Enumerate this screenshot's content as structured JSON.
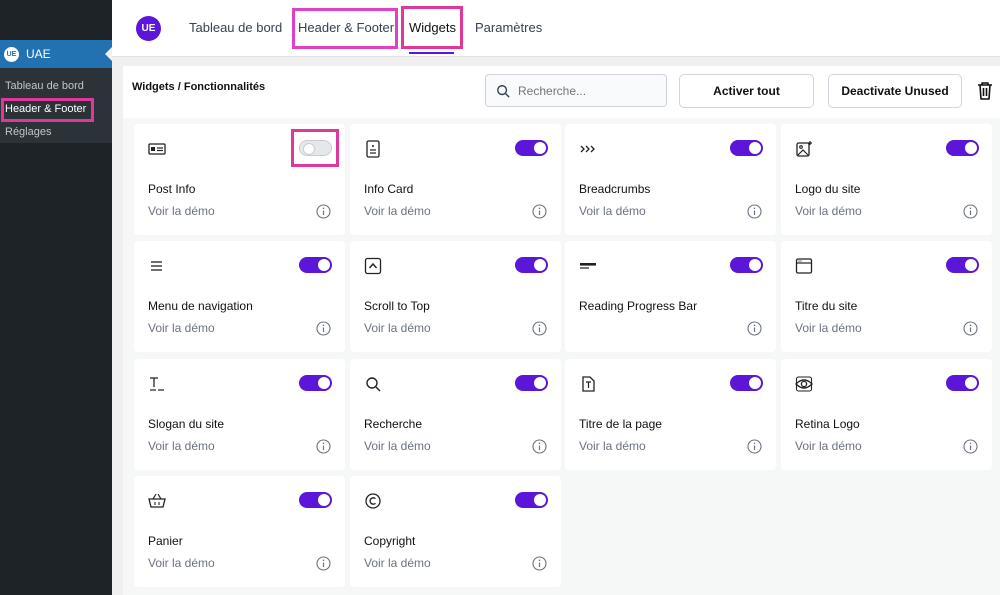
{
  "wp_sidebar": {
    "menu_label": "UAE",
    "menu_icon_text": "UE",
    "submenu": [
      "Tableau de bord",
      "Header & Footer",
      "Réglages"
    ]
  },
  "header": {
    "logo_text": "UE",
    "tabs": [
      "Tableau de bord",
      "Header & Footer",
      "Widgets",
      "Paramètres"
    ],
    "active_tab": "Widgets"
  },
  "toolbar": {
    "title": "Widgets / Fonctionnalités",
    "search_placeholder": "Recherche...",
    "activate_all": "Activer tout",
    "deactivate_unused": "Deactivate Unused"
  },
  "demo_label": "Voir la démo",
  "widgets": [
    {
      "name": "Post Info",
      "icon": "post-info-icon",
      "enabled": false,
      "demo": true
    },
    {
      "name": "Info Card",
      "icon": "info-card-icon",
      "enabled": true,
      "demo": true
    },
    {
      "name": "Breadcrumbs",
      "icon": "breadcrumbs-icon",
      "enabled": true,
      "demo": true
    },
    {
      "name": "Logo du site",
      "icon": "site-logo-icon",
      "enabled": true,
      "demo": true
    },
    {
      "name": "Menu de navigation",
      "icon": "menu-icon",
      "enabled": true,
      "demo": true
    },
    {
      "name": "Scroll to Top",
      "icon": "scroll-top-icon",
      "enabled": true,
      "demo": true
    },
    {
      "name": "Reading Progress Bar",
      "icon": "progress-bar-icon",
      "enabled": true,
      "demo": false
    },
    {
      "name": "Titre du site",
      "icon": "site-title-icon",
      "enabled": true,
      "demo": true
    },
    {
      "name": "Slogan du site",
      "icon": "tagline-icon",
      "enabled": true,
      "demo": true
    },
    {
      "name": "Recherche",
      "icon": "search-icon",
      "enabled": true,
      "demo": true
    },
    {
      "name": "Titre de la page",
      "icon": "page-title-icon",
      "enabled": true,
      "demo": true
    },
    {
      "name": "Retina Logo",
      "icon": "retina-logo-icon",
      "enabled": true,
      "demo": true
    },
    {
      "name": "Panier",
      "icon": "cart-icon",
      "enabled": true,
      "demo": true
    },
    {
      "name": "Copyright",
      "icon": "copyright-icon",
      "enabled": true,
      "demo": true
    }
  ],
  "colors": {
    "accent": "#5b16d8",
    "highlight": "#e0389a",
    "wp_blue": "#2271b1"
  }
}
